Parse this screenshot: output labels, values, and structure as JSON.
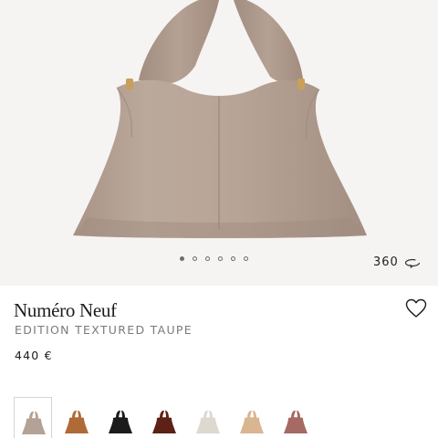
{
  "product": {
    "name": "Numéro Neuf",
    "edition": "EDITION TEXTURED TAUPE",
    "price": "440 €"
  },
  "gallery": {
    "image_count": 6,
    "active_index": 0,
    "view_360_label": "360",
    "bag_color": "#b8a497"
  },
  "icons": {
    "rotate": "rotate-360-icon",
    "wishlist": "heart-outline-icon"
  },
  "swatches": [
    {
      "name": "taupe",
      "color": "#b3a295",
      "selected": true
    },
    {
      "name": "cognac",
      "color": "#b06a38",
      "selected": false
    },
    {
      "name": "black",
      "color": "#1c1b1b",
      "selected": false
    },
    {
      "name": "burgundy",
      "color": "#5e2117",
      "selected": false
    },
    {
      "name": "chalk",
      "color": "#ddd8d0",
      "selected": false
    },
    {
      "name": "camel",
      "color": "#d9b592",
      "selected": false
    },
    {
      "name": "rose",
      "color": "#a46a63",
      "selected": false
    }
  ]
}
